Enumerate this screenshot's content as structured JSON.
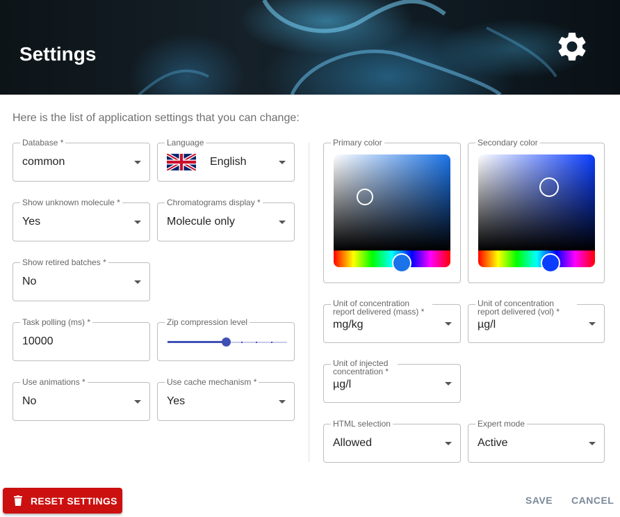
{
  "header": {
    "title": "Settings",
    "gear_icon": "gear-icon"
  },
  "intro": "Here is the list of application settings that you can change:",
  "fields": {
    "database": {
      "label": "Database *",
      "value": "common"
    },
    "language": {
      "label": "Language",
      "value": "English",
      "flag": "uk-flag-icon"
    },
    "show_unknown_molecule": {
      "label": "Show unknown molecule *",
      "value": "Yes"
    },
    "chromatograms_display": {
      "label": "Chromatograms display *",
      "value": "Molecule only"
    },
    "show_retired_batches": {
      "label": "Show retired batches *",
      "value": "No"
    },
    "task_polling": {
      "label": "Task polling (ms) *",
      "value": "10000"
    },
    "zip_compression": {
      "label": "Zip compression level",
      "level": 5,
      "max": 9
    },
    "use_animations": {
      "label": "Use animations *",
      "value": "No"
    },
    "use_cache": {
      "label": "Use cache mechanism *",
      "value": "Yes"
    },
    "primary_color": {
      "label": "Primary color",
      "hue_color": "#1a73e8"
    },
    "secondary_color": {
      "label": "Secondary color",
      "hue_color": "#0a3dff"
    },
    "unit_mass": {
      "label": "Unit of concentration report delivered (mass) *",
      "value": "mg/kg"
    },
    "unit_vol": {
      "label": "Unit of concentration report delivered (vol) *",
      "value": "µg/l"
    },
    "unit_injected": {
      "label": "Unit of injected concentration *",
      "value": "µg/l"
    },
    "html_selection": {
      "label": "HTML selection",
      "value": "Allowed"
    },
    "expert_mode": {
      "label": "Expert mode",
      "value": "Active"
    }
  },
  "actions": {
    "reset": "RESET SETTINGS",
    "save": "SAVE",
    "cancel": "CANCEL"
  }
}
